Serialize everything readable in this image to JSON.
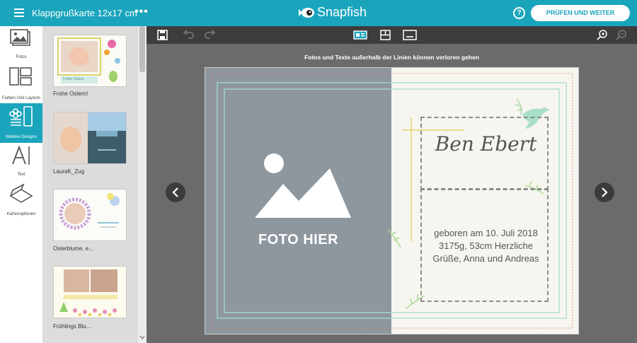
{
  "header": {
    "doc_title": "Klappgrußkarte 12x17 cm",
    "more": "•••",
    "brand": "Snapfish",
    "help": "?",
    "proceed_label": "PRÜFEN UND WEITER"
  },
  "rail": {
    "items": [
      {
        "label": "Fotos",
        "icon": "photos-icon"
      },
      {
        "label": "Farben Und Layouts",
        "icon": "layouts-icon"
      },
      {
        "label": "Weitere Designs",
        "icon": "designs-icon"
      },
      {
        "label": "Text",
        "icon": "text-icon"
      },
      {
        "label": "Kartenoptionen",
        "icon": "card-options-icon"
      }
    ]
  },
  "designs": [
    {
      "label": "Frohe Ostern!",
      "thumb_text": "Frohe Ostern"
    },
    {
      "label": "LauraK_Zug",
      "thumb_text": ""
    },
    {
      "label": "Osterblume, e...",
      "thumb_text": ""
    },
    {
      "label": "Frühlings Blu...",
      "thumb_text": ""
    }
  ],
  "toolbar": {
    "icons": [
      "save-icon",
      "undo-icon",
      "redo-icon",
      "layout-single-icon",
      "layout-grid-icon",
      "layout-bottom-icon",
      "zoom-in-icon",
      "zoom-out-icon"
    ]
  },
  "canvas": {
    "warning": "Fotos und Texte außerhalb der Linien können verloren gehen",
    "photo_placeholder": "FOTO HIER",
    "name": "Ben Ebert",
    "info_lines": [
      "geboren am 10. Juli 2018",
      "3175g, 53cm  Herzliche",
      "Grüße, Anna und Andreas"
    ]
  },
  "colors": {
    "accent": "#1aa5bd",
    "toolbar": "#3d3d3d",
    "canvas_bg": "#6b6b6b",
    "photo_placeholder": "#8e969e",
    "card_bg": "#f7f5ef",
    "frame_line": "#a8dcc8",
    "crosshair": "#e3d36a",
    "bleed_red": "#d98080"
  }
}
